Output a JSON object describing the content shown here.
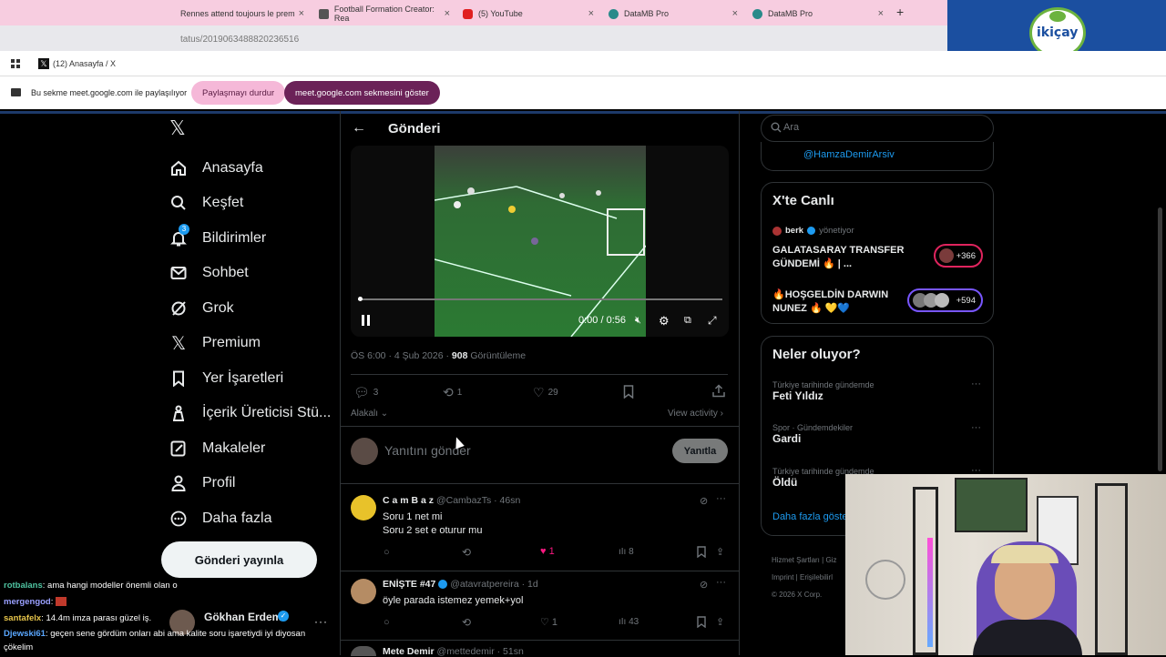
{
  "browser": {
    "tabs": [
      {
        "label": "Rennes attend toujours le prem",
        "color": "#e8913a"
      },
      {
        "label": "Football Formation Creator: Rea",
        "color": "#444"
      },
      {
        "label": "(5) YouTube",
        "color": "#e02020"
      },
      {
        "label": "DataMB Pro",
        "color": "#2a8a8a"
      },
      {
        "label": "DataMB Pro",
        "color": "#2a8a8a"
      }
    ],
    "new_tab": "+",
    "url": "tatus/2019063488820236516",
    "bookmark_tab": "(12) Anasayfa / X"
  },
  "share": {
    "message": "Bu sekme meet.google.com ile paylaşılıyor",
    "stop_label": "Paylaşmayı durdur",
    "show_label": "meet.google.com sekmesini göster"
  },
  "logo": {
    "text": "ikiçay"
  },
  "sidebar": {
    "items": [
      {
        "label": "Anasayfa",
        "icon": "home-icon"
      },
      {
        "label": "Keşfet",
        "icon": "search-icon"
      },
      {
        "label": "Bildirimler",
        "icon": "bell-icon",
        "badge": "3"
      },
      {
        "label": "Sohbet",
        "icon": "mail-icon"
      },
      {
        "label": "Grok",
        "icon": "grok-icon"
      },
      {
        "label": "Premium",
        "icon": "x-icon"
      },
      {
        "label": "Yer İşaretleri",
        "icon": "bookmark-icon"
      },
      {
        "label": "İçerik Üreticisi Stü...",
        "icon": "creator-icon"
      },
      {
        "label": "Makaleler",
        "icon": "article-icon"
      },
      {
        "label": "Profil",
        "icon": "profile-icon"
      },
      {
        "label": "Daha fazla",
        "icon": "more-icon"
      }
    ],
    "post_button": "Gönderi yayınla",
    "account_name": "Gökhan Erdem"
  },
  "chat": [
    {
      "user": "rotbalans",
      "color": "#4fc3a1",
      "text": ": ama hangi modeller önemli olan o"
    },
    {
      "user": "mergengod",
      "color": "#9aa0ff",
      "text": ":"
    },
    {
      "user": "santafelx",
      "color": "#e6c44a",
      "text": ": 14.4m imza parası güzel iş."
    },
    {
      "user": "Djewski61",
      "color": "#5aa7ff",
      "text": ": geçen sene gördüm onları abi ama kalite soru işaretiydi iyi diyosan"
    },
    {
      "user": "",
      "color": "#fff",
      "text": "çökelim"
    }
  ],
  "post": {
    "header": "Gönderi",
    "video": {
      "time": "0:00 / 0:56",
      "progress": 0.0
    },
    "meta_time": "ÖS 6:00 · 4 Şub 2026 ·",
    "views_count": "908",
    "views_label": "Görüntüleme",
    "stats": {
      "replies": "3",
      "reposts": "1",
      "likes": "29"
    },
    "sort_label": "Alakalı",
    "view_activity": "View activity",
    "reply_placeholder": "Yanıtını gönder",
    "reply_button": "Yanıtla"
  },
  "replies": [
    {
      "name": "C a m B a z",
      "handle": "@CambazTs",
      "time": "· 46sn",
      "text1": "Soru 1 net mi",
      "text2": "Soru 2 set e oturur mu",
      "likes": "1",
      "views": "8",
      "liked": true
    },
    {
      "name": "ENİŞTE #47",
      "handle": "@atavratpereira",
      "time": "· 1d",
      "text1": "öyle parada istemez yemek+yol",
      "text2": "",
      "likes": "1",
      "views": "43",
      "liked": false
    },
    {
      "name": "Mete Demir",
      "handle": "@mettedemir",
      "time": "· 51sn",
      "text1": "",
      "text2": "",
      "likes": "",
      "views": "",
      "liked": false
    }
  ],
  "right": {
    "search_placeholder": "Ara",
    "profile_handle": "@HamzaDemirArsiv",
    "live_title": "X'te Canlı",
    "live_host": "berk",
    "live_host_role": "yönetiyor",
    "live_items": [
      {
        "title": "GALATASARAY TRANSFER GÜNDEMİ 🔥 | ...",
        "count": "+366",
        "border": "#e0245e"
      },
      {
        "title": "🔥HOŞGELDİN DARWIN NUNEZ 🔥 💛💙",
        "count": "+594",
        "border": "#7856ff"
      }
    ],
    "trends_title": "Neler oluyor?",
    "trends": [
      {
        "context": "Türkiye tarihinde gündemde",
        "name": "Feti Yıldız"
      },
      {
        "context": "Spor · Gündemdekiler",
        "name": "Gardi"
      },
      {
        "context": "Türkiye tarihinde gündemde",
        "name": "Öldü"
      }
    ],
    "show_more": "Daha fazla göste",
    "footer": {
      "terms": "Hizmet Şartları",
      "g": "Giz",
      "imprint": "Imprint",
      "access": "Erişilebilirl",
      "copyright": "© 2026 X Corp."
    }
  }
}
